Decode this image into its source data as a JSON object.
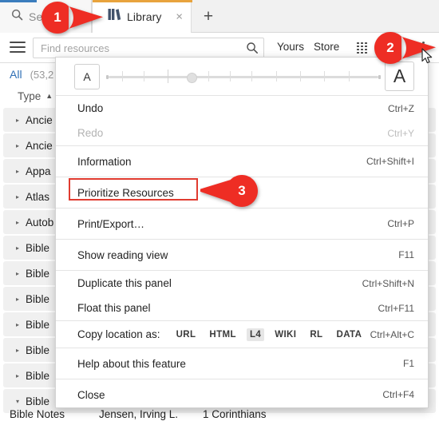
{
  "window": {
    "title": "Library"
  },
  "tabs": {
    "inactive": {
      "label": "Search",
      "icon": "search-icon",
      "accent_color": "#3b7dbd"
    },
    "active": {
      "label": "Library",
      "icon": "books-icon",
      "close_label": "×",
      "accent_color": "#e8a33d"
    },
    "new_tab_label": "+"
  },
  "toolbar": {
    "menu_icon": "hamburger-icon",
    "search_placeholder": "Find resources",
    "search_value": "",
    "search_icon": "magnifier-icon",
    "yours_label": "Yours",
    "store_label": "Store",
    "grid_icon": "grid-view-icon",
    "kebab_icon": "more-options-icon"
  },
  "sidebar": {
    "all_label": "All",
    "all_count": "(53,2",
    "column_header": "Type",
    "sort_caret": "▲",
    "rows": [
      {
        "arrow": "▸",
        "label": "Ancie"
      },
      {
        "arrow": "▸",
        "label": "Ancie"
      },
      {
        "arrow": "▸",
        "label": "Appa"
      },
      {
        "arrow": "▸",
        "label": "Atlas"
      },
      {
        "arrow": "▸",
        "label": "Autob"
      },
      {
        "arrow": "▸",
        "label": "Bible"
      },
      {
        "arrow": "▸",
        "label": "Bible"
      },
      {
        "arrow": "▸",
        "label": "Bible"
      },
      {
        "arrow": "▸",
        "label": "Bible"
      },
      {
        "arrow": "▸",
        "label": "Bible"
      },
      {
        "arrow": "▸",
        "label": "Bible"
      },
      {
        "arrow": "▾",
        "label": "Bible"
      }
    ],
    "detail_row": {
      "type": "Bible Notes",
      "author": "Jensen, Irving L.",
      "title": "1 Corinthians"
    }
  },
  "menu": {
    "zoom_control": {
      "small_a": "A",
      "large_a": "A",
      "thumb_percent": 30
    },
    "groups": [
      {
        "items": [
          {
            "label": "Undo",
            "accel": "Ctrl+Z",
            "disabled": false
          },
          {
            "label": "Redo",
            "accel": "Ctrl+Y",
            "disabled": true
          }
        ]
      },
      {
        "items": [
          {
            "label": "Information",
            "accel": "Ctrl+Shift+I",
            "disabled": false
          }
        ]
      },
      {
        "items": [
          {
            "label": "Prioritize Resources",
            "accel": "",
            "disabled": false,
            "highlighted": true
          }
        ]
      },
      {
        "items": [
          {
            "label": "Print/Export…",
            "accel": "Ctrl+P",
            "disabled": false
          }
        ]
      },
      {
        "items": [
          {
            "label": "Show reading view",
            "accel": "F11",
            "disabled": false
          }
        ]
      },
      {
        "items": [
          {
            "label": "Duplicate this panel",
            "accel": "Ctrl+Shift+N",
            "disabled": false
          },
          {
            "label": "Float this panel",
            "accel": "Ctrl+F11",
            "disabled": false
          }
        ]
      },
      {
        "copy_row": {
          "label": "Copy location as:",
          "accel": "Ctrl+Alt+C",
          "formats": [
            {
              "label": "URL",
              "selected": false
            },
            {
              "label": "HTML",
              "selected": false
            },
            {
              "label": "L4",
              "selected": true
            },
            {
              "label": "WIKI",
              "selected": false
            },
            {
              "label": "RL",
              "selected": false
            },
            {
              "label": "DATA",
              "selected": false
            }
          ]
        }
      },
      {
        "items": [
          {
            "label": "Help about this feature",
            "accel": "F1",
            "disabled": false
          }
        ]
      },
      {
        "items": [
          {
            "label": "Close",
            "accel": "Ctrl+F4",
            "disabled": false
          }
        ]
      }
    ]
  },
  "callouts": [
    {
      "number": "1",
      "color": "#ee2d24"
    },
    {
      "number": "2",
      "color": "#ee2d24"
    },
    {
      "number": "3",
      "color": "#ee2d24"
    }
  ],
  "highlight": {
    "color": "#e03b30"
  }
}
